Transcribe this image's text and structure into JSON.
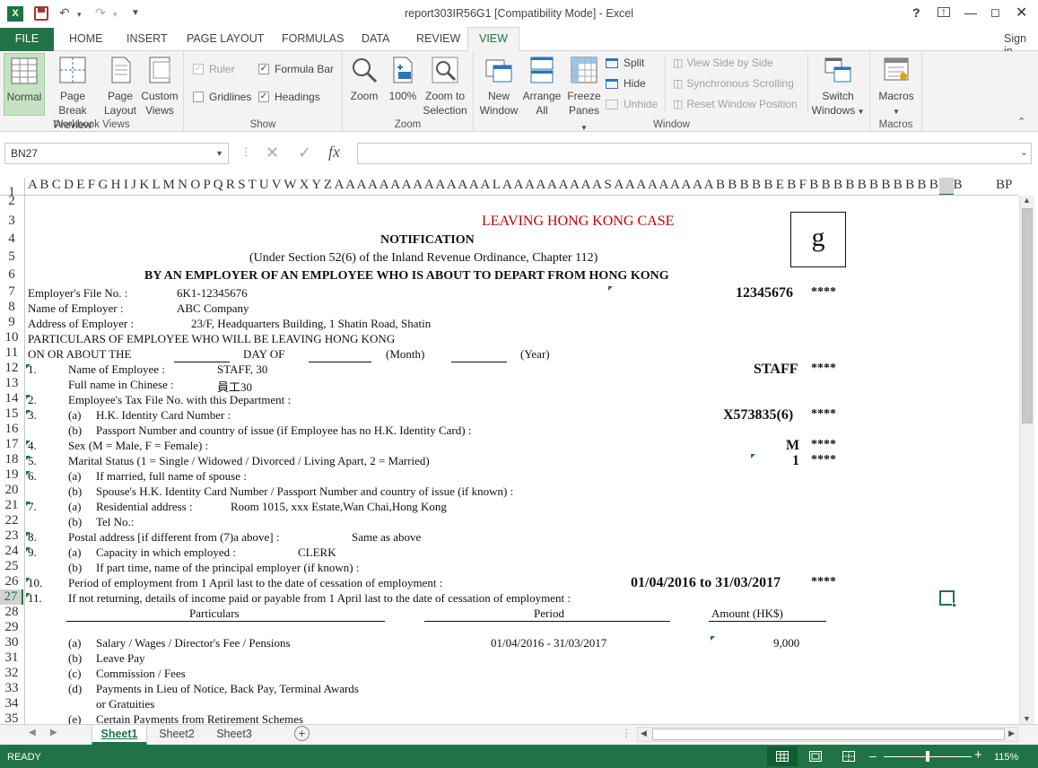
{
  "window": {
    "title": "report303IR56G1  [Compatibility Mode] - Excel"
  },
  "quick_access": {
    "save_label": "Save",
    "undo_label": "Undo",
    "redo_label": "Redo"
  },
  "ribbon_tabs": [
    "FILE",
    "HOME",
    "INSERT",
    "PAGE LAYOUT",
    "FORMULAS",
    "DATA",
    "REVIEW",
    "VIEW"
  ],
  "active_tab": "VIEW",
  "sign_in": "Sign in",
  "groups": {
    "workbook_views": {
      "label": "Workbook Views",
      "normal": "Normal",
      "page_break_1": "Page Break",
      "page_break_2": "Preview",
      "page_layout_1": "Page",
      "page_layout_2": "Layout",
      "custom_1": "Custom",
      "custom_2": "Views"
    },
    "show": {
      "label": "Show",
      "ruler": "Ruler",
      "formula_bar": "Formula Bar",
      "gridlines": "Gridlines",
      "headings": "Headings"
    },
    "zoom": {
      "label": "Zoom",
      "zoom": "Zoom",
      "hundred": "100%",
      "sel_1": "Zoom to",
      "sel_2": "Selection"
    },
    "window": {
      "label": "Window",
      "new_1": "New",
      "new_2": "Window",
      "arrange_1": "Arrange",
      "arrange_2": "All",
      "freeze_1": "Freeze",
      "freeze_2": "Panes",
      "split": "Split",
      "hide": "Hide",
      "unhide": "Unhide",
      "side": "View Side by Side",
      "sync": "Synchronous Scrolling",
      "reset": "Reset Window Position",
      "switch_1": "Switch",
      "switch_2": "Windows"
    },
    "macros": {
      "label": "Macros",
      "macros": "Macros"
    }
  },
  "name_box": "BN27",
  "formula_content": "",
  "column_headers": "A B C D E F G H I  J  K L M N O P Q R S T U V W X  Y  Z A A A A A A A A A A A A A A L A A A A A A A A A S A A A A A A A A A B B B B B E B F B B B B B B B B B B B B B",
  "last_col_header": "BP",
  "rows": [
    "1",
    "2",
    "3",
    "4",
    "5",
    "6",
    "7",
    "8",
    "9",
    "10",
    "11",
    "12",
    "13",
    "14",
    "15",
    "16",
    "17",
    "18",
    "19",
    "20",
    "21",
    "22",
    "23",
    "24",
    "25",
    "26",
    "27",
    "28",
    "29",
    "30",
    "31",
    "32",
    "33",
    "34",
    "35"
  ],
  "form": {
    "case_title": "LEAVING HONG KONG CASE",
    "box_letter": "g",
    "notification": "NOTIFICATION",
    "under_section": "(Under Section 52(6) of the Inland Revenue Ordinance, Chapter 112)",
    "heading": "BY AN EMPLOYER OF AN EMPLOYEE WHO IS ABOUT TO DEPART FROM HONG KONG",
    "file_no_label": "Employer's File No. :",
    "file_no": "6K1-12345676",
    "file_no_big": "12345676",
    "name_employer_label": "Name of Employer :",
    "name_employer": "ABC Company",
    "address_label": "Address of Employer :",
    "address": "23/F, Headquarters Building, 1 Shatin Road, Shatin",
    "particulars": "PARTICULARS OF EMPLOYEE WHO WILL BE LEAVING HONG KONG",
    "on_or_about": "ON OR ABOUT THE",
    "day_of": "DAY OF",
    "month": "(Month)",
    "year": "(Year)",
    "n1": "1.",
    "name_employee_label": "Name of Employee :",
    "name_employee": "STAFF, 30",
    "name_big": "STAFF",
    "chinese_label": "Full name in Chinese :",
    "chinese_name": "員工30",
    "n2": "2.",
    "tax_file": "Employee's Tax File No. with this Department :",
    "n3": "3.",
    "a": "(a)",
    "b": "(b)",
    "c": "(c)",
    "d": "(d)",
    "e": "(e)",
    "hkid_label": "H.K. Identity Card Number :",
    "hkid": "X573835(6)",
    "passport_label": "Passport Number and country of issue (if Employee has no H.K. Identity Card) :",
    "n4": "4.",
    "sex_label": "Sex (M = Male, F = Female) :",
    "sex": "M",
    "n5": "5.",
    "marital_label": "Marital Status (1 = Single / Widowed / Divorced / Living Apart, 2 = Married)",
    "marital": "1",
    "n6": "6.",
    "spouse_label": "If married, full name of spouse :",
    "spouse_id": "Spouse's H.K. Identity Card Number / Passport Number and country of issue (if known) :",
    "n7": "7.",
    "res_label": "Residential address :",
    "res": "Room 1015, xxx Estate,Wan Chai,Hong Kong",
    "tel": "Tel No.:",
    "n8": "8.",
    "postal_label": "Postal address [if different from (7)a above] :",
    "postal": "Same as above",
    "n9": "9.",
    "capacity_label": "Capacity in which employed :",
    "capacity": "CLERK",
    "part_time": "If part time, name of the principal employer (if known) :",
    "n10": "10.",
    "period_label": "Period of employment from 1 April last to the date of cessation of employment :",
    "period": "01/04/2016 to 31/03/2017",
    "n11": "11.",
    "not_returning": "If not returning, details of income paid or payable from 1 April last to the date of cessation of employment :",
    "col_particulars": "Particulars",
    "col_period": "Period",
    "col_amount": "Amount (HK$)",
    "salary": "Salary / Wages / Director's Fee / Pensions",
    "salary_period": "01/04/2016 - 31/03/2017",
    "salary_amount": "9,000",
    "leave_pay": "Leave Pay",
    "commission": "Commission / Fees",
    "payments": "Payments in Lieu of Notice, Back Pay, Terminal Awards",
    "gratuities": "or Gratuities",
    "retirement": "Certain Payments from Retirement Schemes",
    "stars": "****"
  },
  "sheet_tabs": [
    "Sheet1",
    "Sheet2",
    "Sheet3"
  ],
  "status": {
    "ready": "READY",
    "zoom": "115%"
  },
  "zoom_slider_fraction": 0.5
}
